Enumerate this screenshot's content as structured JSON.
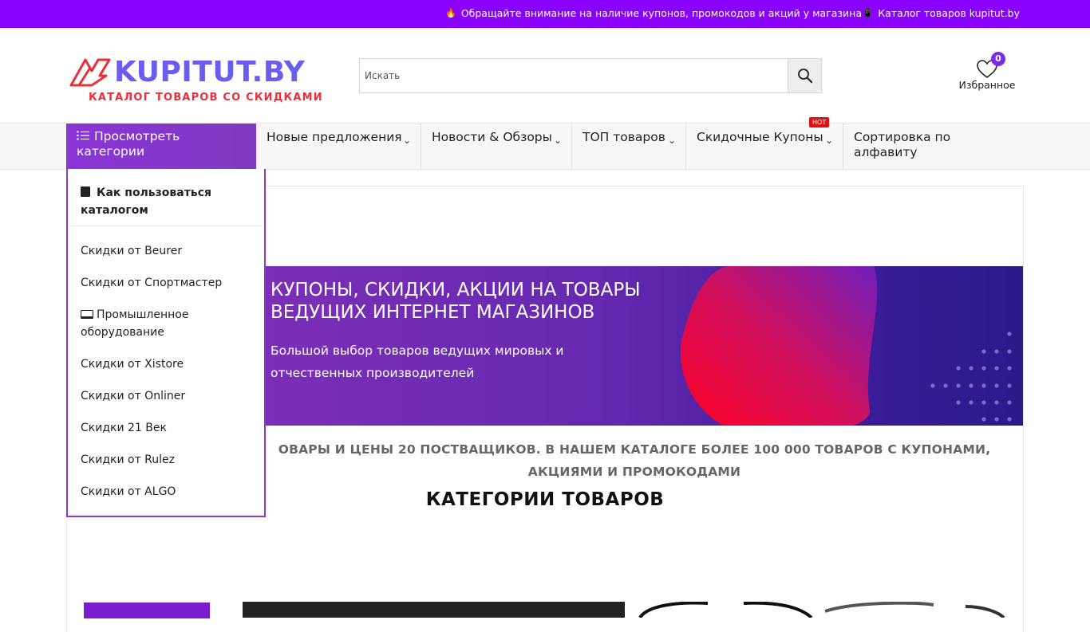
{
  "topbar": {
    "notice": "Обращайте внимание на наличие купонов, промокодов и акций у магазина",
    "catalog": "Каталог товаров kupitut.by",
    "notice_icon": "fire-icon",
    "catalog_icon": "phone-icon"
  },
  "header": {
    "logo_text": "KUPITUT.BY",
    "logo_tagline": "КАТАЛОГ ТОВАРОВ СО СКИДКАМИ",
    "search_placeholder": "Искать",
    "favorites_label": "Избранное",
    "favorites_count": "0"
  },
  "nav": {
    "categories_button": "Просмотреть категории",
    "items": [
      {
        "label": "Новые предложения"
      },
      {
        "label": "Новости & Обзоры"
      },
      {
        "label": "ТОП товаров"
      },
      {
        "label": "Скидочные Купоны"
      },
      {
        "label": "Сортировка по алфавиту"
      }
    ],
    "hot_badge": "HOT"
  },
  "dropdown": {
    "head": "Как пользоваться каталогом",
    "items": [
      "Скидки от Beurer",
      "Скидки от Спортмастер",
      "Промышленное оборудование",
      "Скидки от Xistore",
      "Скидки от Onliner",
      "Скидки 21 Век",
      "Скидки от Rulez",
      "Скидки от ALGO"
    ]
  },
  "banner": {
    "title": "КУПОНЫ, СКИДКИ, АКЦИИ НА ТОВАРЫ ВЕДУЩИХ ИНТЕРНЕТ МАГАЗИНОВ",
    "subtitle": "Большой выбор товаров ведущих мировых и отчественных производителей"
  },
  "promo_text": "ОВАРЫ И ЦЕНЫ 20 ПОСТВАЩИКОВ. В НАШЕМ КАТАЛОГЕ БОЛЕЕ 100 000 ТОВАРОВ С КУПОНАМИ, АКЦИЯМИ И ПРОМОКОДАМИ",
  "categories_heading": "КАТЕГОРИИ ТОВАРОВ",
  "colors": {
    "topbar": "#8a00ff",
    "accent": "#7d2ae8",
    "logo": "#6b5cf0",
    "tagline": "#e8303a"
  }
}
